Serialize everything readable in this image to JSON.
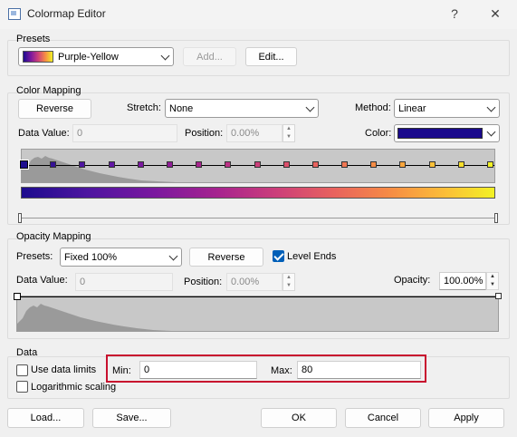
{
  "window": {
    "title": "Colormap Editor",
    "help_label": "?",
    "close_label": "✕"
  },
  "presets": {
    "group_title": "Presets",
    "selected": "Purple-Yellow",
    "add_label": "Add...",
    "edit_label": "Edit..."
  },
  "color_mapping": {
    "group_title": "Color Mapping",
    "reverse_label": "Reverse",
    "stretch_label": "Stretch:",
    "stretch_value": "None",
    "method_label": "Method:",
    "method_value": "Linear",
    "data_value_label": "Data Value:",
    "data_value": "0",
    "position_label": "Position:",
    "position_value": "0.00%",
    "color_label": "Color:",
    "color_value": "#1a0a8c",
    "node_colors": [
      "#1d0c8e",
      "#351195",
      "#4e16a0",
      "#6117a4",
      "#7a189f",
      "#901d98",
      "#a8248e",
      "#bd3186",
      "#cc3f7a",
      "#dc4f6b",
      "#e8625e",
      "#f07753",
      "#f68c45",
      "#f9a53c",
      "#fbc038",
      "#f8df2b",
      "#f2f125"
    ]
  },
  "opacity_mapping": {
    "group_title": "Opacity Mapping",
    "presets_label": "Presets:",
    "presets_value": "Fixed 100%",
    "reverse_label": "Reverse",
    "level_ends_label": "Level Ends",
    "level_ends_checked": true,
    "data_value_label": "Data Value:",
    "data_value": "0",
    "position_label": "Position:",
    "position_value": "0.00%",
    "opacity_label": "Opacity:",
    "opacity_value": "100.00%"
  },
  "data_section": {
    "group_title": "Data",
    "use_limits_label": "Use data limits",
    "log_scaling_label": "Logarithmic scaling",
    "min_label": "Min:",
    "min_value": "0",
    "max_label": "Max:",
    "max_value": "80"
  },
  "footer": {
    "load_label": "Load...",
    "save_label": "Save...",
    "ok_label": "OK",
    "cancel_label": "Cancel",
    "apply_label": "Apply"
  }
}
